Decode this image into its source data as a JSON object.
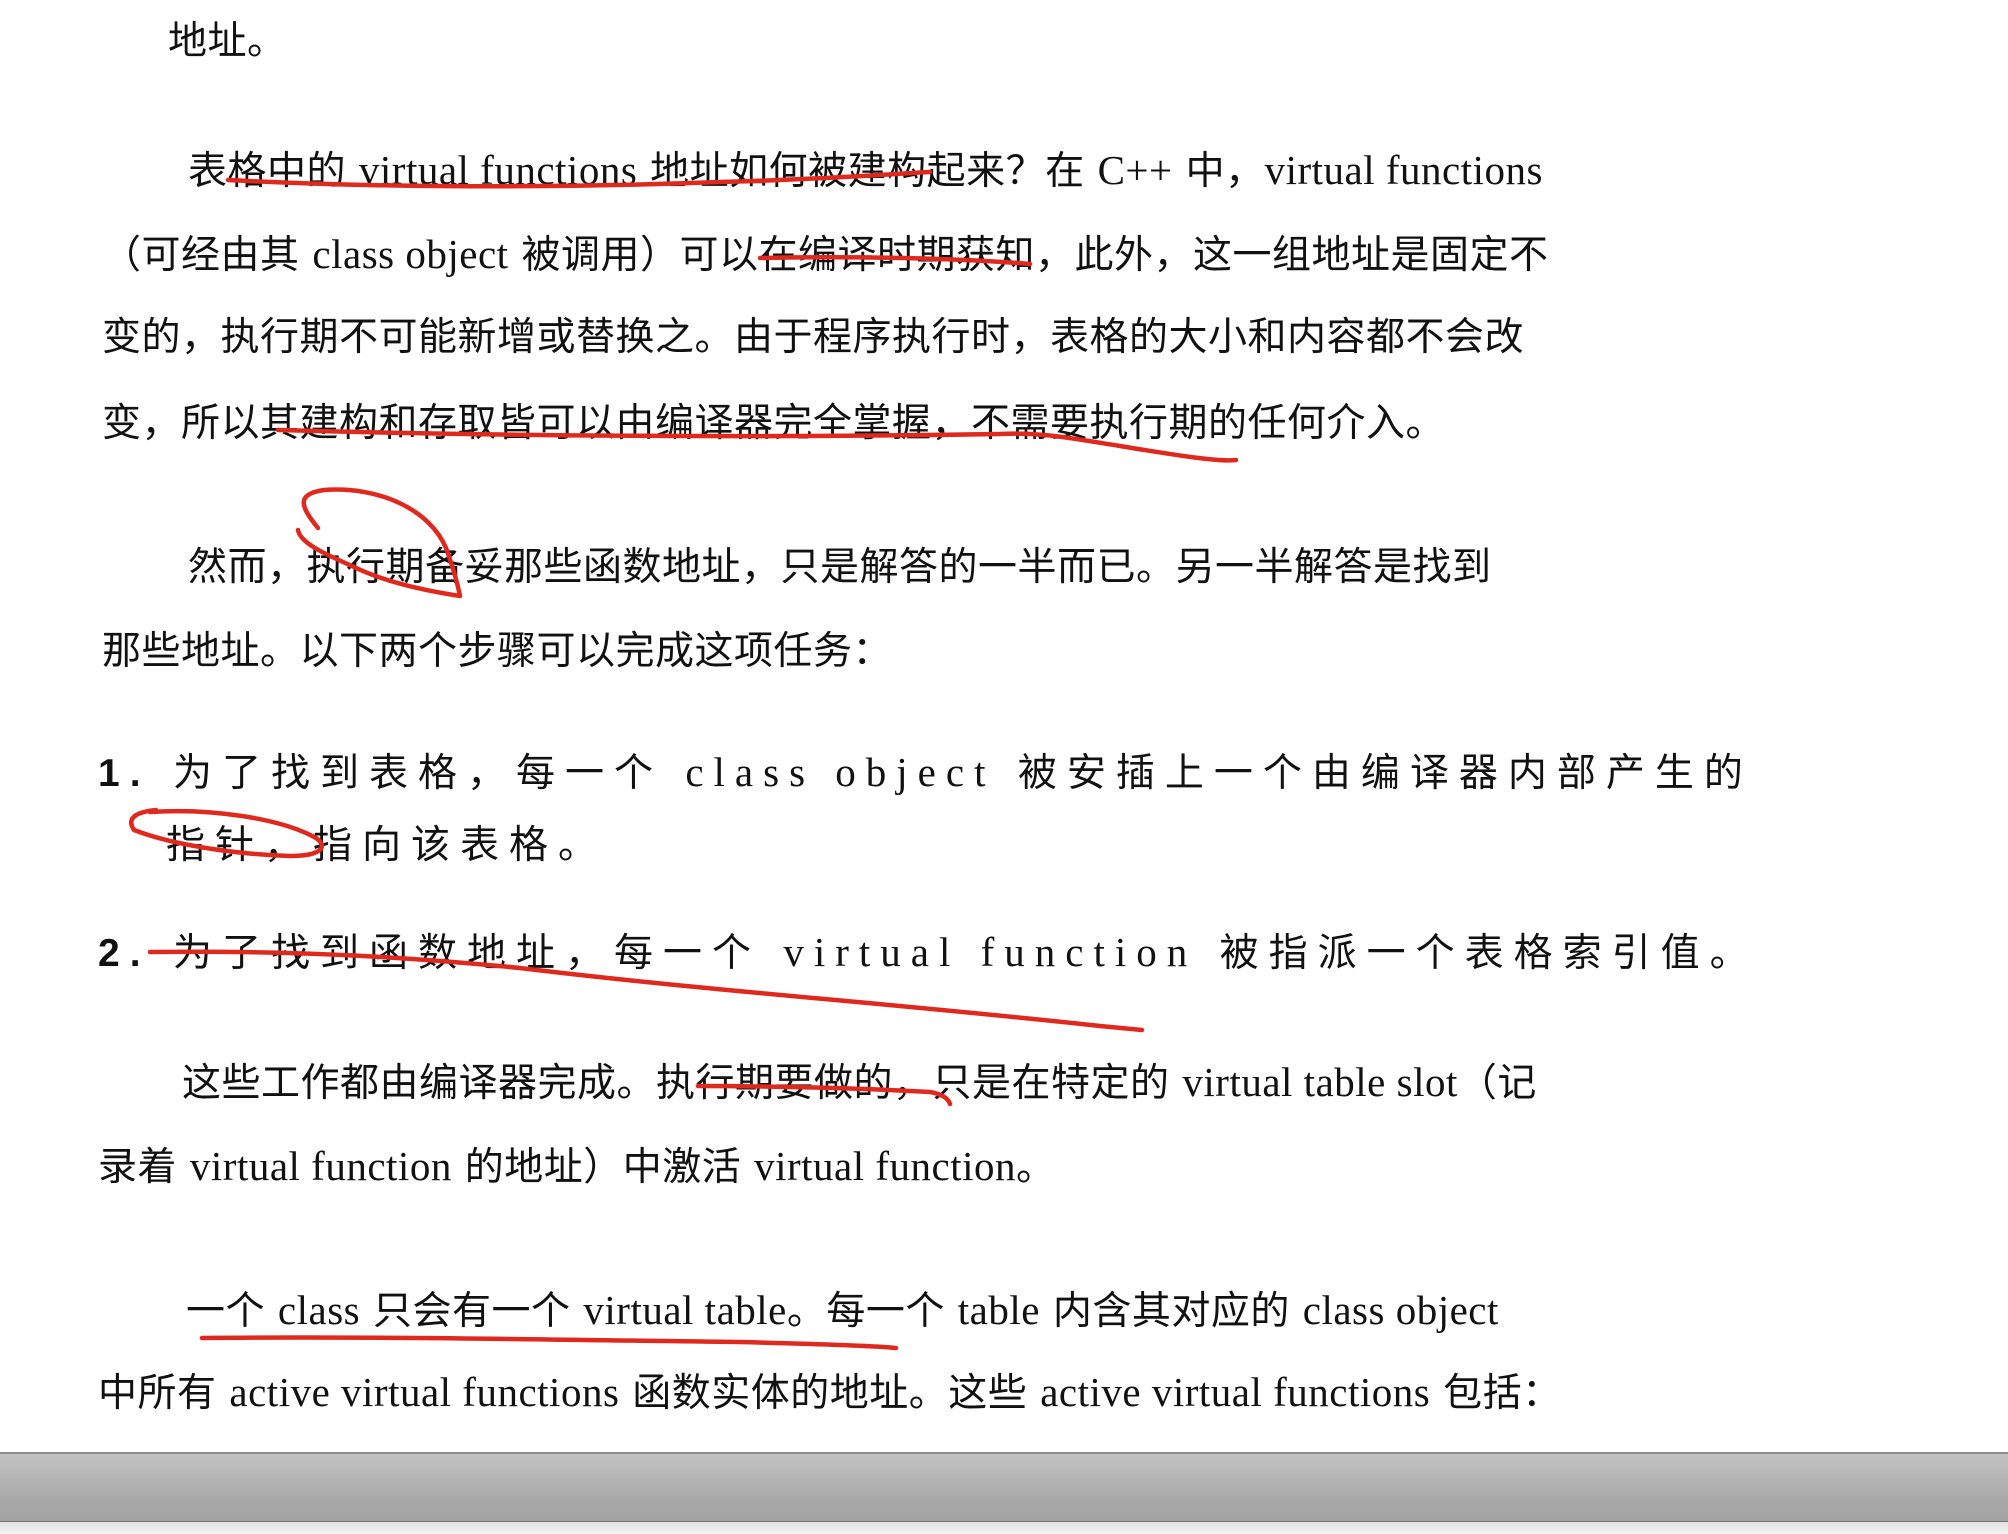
{
  "paragraphs": {
    "p0": {
      "line1": "地址。"
    },
    "p1": {
      "line1_pre": "表格中的 ",
      "line1_latin": "virtual functions",
      "line1_mid": " 地址如何被建构起来？在 ",
      "line1_cpp": "C++",
      "line1_mid2": " 中，",
      "line1_latin2": "virtual functions",
      "line2_pre": "（可经由其 ",
      "line2_latin": "class object",
      "line2_post": " 被调用）可以在编译时期获知，此外，这一组地址是固定不",
      "line3": "变的，执行期不可能新增或替换之。由于程序执行时，表格的大小和内容都不会改",
      "line4": "变，所以其建构和存取皆可以由编译器完全掌握，不需要执行期的任何介入。"
    },
    "p2": {
      "line1": "然而，执行期备妥那些函数地址，只是解答的一半而已。另一半解答是找到",
      "line2": "那些地址。以下两个步骤可以完成这项任务："
    },
    "list": {
      "item1_num": "1.",
      "item1_pre": "为了找到表格，每一个 ",
      "item1_latin": "class object",
      "item1_post": " 被安插上一个由编译器内部产生的",
      "item1_line2": "指针，指向该表格。",
      "item2_num": "2.",
      "item2_pre": "为了找到函数地址，每一个 ",
      "item2_latin": "virtual function",
      "item2_post": " 被指派一个表格索引值。"
    },
    "p3": {
      "line1_pre": "这些工作都由编译器完成。执行期要做的，只是在特定的 ",
      "line1_latin": "virtual table slot",
      "line1_post": "（记",
      "line2_pre": "录着 ",
      "line2_latin": "virtual function",
      "line2_mid": " 的地址）中激活 ",
      "line2_latin2": "virtual function",
      "line2_post": "。"
    },
    "p4": {
      "line1_pre": "一个 ",
      "line1_latin": "class",
      "line1_mid": " 只会有一个 ",
      "line1_latin2": "virtual table",
      "line1_mid2": "。每一个 ",
      "line1_latin3": "table",
      "line1_mid3": " 内含其对应的 ",
      "line1_latin4": "class object",
      "line2_pre": "中所有 ",
      "line2_latin": "active virtual functions",
      "line2_mid": " 函数实体的地址。这些 ",
      "line2_latin2": "active virtual functions",
      "line2_post": " 包括："
    }
  },
  "annotation_color": "#e0291e",
  "text_color": "#111111"
}
